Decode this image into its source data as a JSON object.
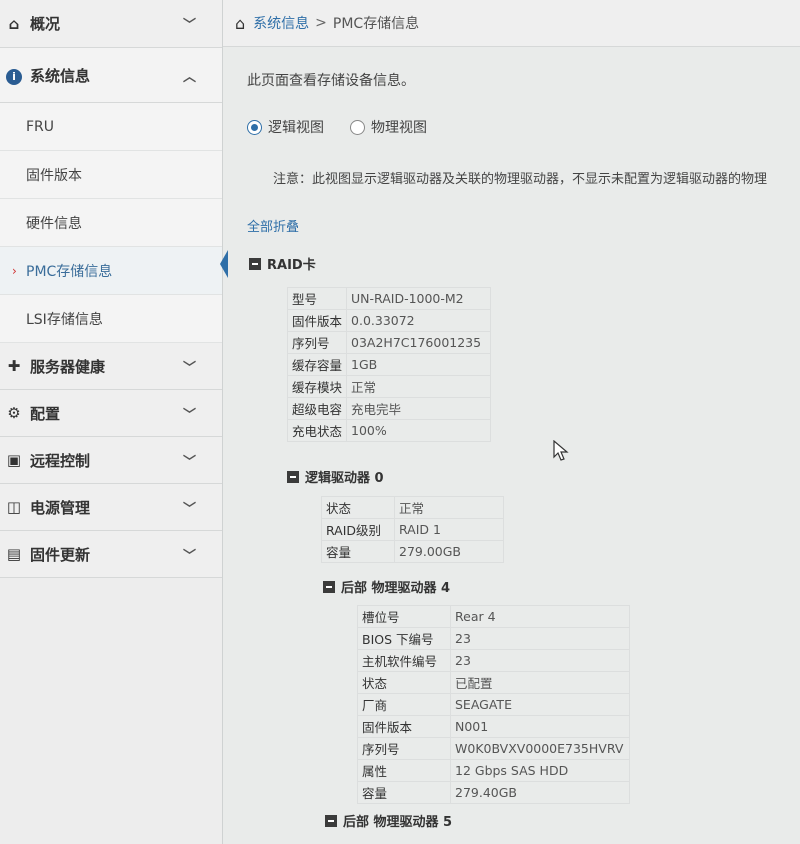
{
  "sidebar": {
    "groups": [
      {
        "label": "概况",
        "icon": "home-icon"
      },
      {
        "label": "系统信息",
        "icon": "info-icon"
      },
      {
        "label": "服务器健康",
        "icon": "health-icon"
      },
      {
        "label": "配置",
        "icon": "gear-icon"
      },
      {
        "label": "远程控制",
        "icon": "monitor-icon"
      },
      {
        "label": "电源管理",
        "icon": "power-icon"
      },
      {
        "label": "固件更新",
        "icon": "firmware-icon"
      }
    ],
    "system_items": [
      {
        "label": "FRU"
      },
      {
        "label": "固件版本"
      },
      {
        "label": "硬件信息"
      },
      {
        "label": "PMC存储信息",
        "active": true
      },
      {
        "label": "LSI存储信息"
      }
    ]
  },
  "breadcrumb": {
    "parent": "系统信息",
    "separator": ">",
    "current": "PMC存储信息"
  },
  "main": {
    "description": "此页面查看存储设备信息。",
    "view_options": [
      {
        "label": "逻辑视图",
        "checked": true
      },
      {
        "label": "物理视图",
        "checked": false
      }
    ],
    "note": "注意：此视图显示逻辑驱动器及关联的物理驱动器，不显示未配置为逻辑驱动器的物理",
    "collapse_all": "全部折叠",
    "raid_card": {
      "title": "RAID卡",
      "rows": [
        {
          "k": "型号",
          "v": "UN-RAID-1000-M2"
        },
        {
          "k": "固件版本",
          "v": "0.0.33072"
        },
        {
          "k": "序列号",
          "v": "03A2H7C176001235"
        },
        {
          "k": "缓存容量",
          "v": "1GB"
        },
        {
          "k": "缓存模块",
          "v": "正常"
        },
        {
          "k": "超级电容",
          "v": "充电完毕"
        },
        {
          "k": "充电状态",
          "v": "100%"
        }
      ]
    },
    "logical_drive": {
      "title": "逻辑驱动器 0",
      "rows": [
        {
          "k": "状态",
          "v": "正常"
        },
        {
          "k": "RAID级别",
          "v": "RAID 1"
        },
        {
          "k": "容量",
          "v": "279.00GB"
        }
      ]
    },
    "physical_drive_4": {
      "title": "后部 物理驱动器 4",
      "rows": [
        {
          "k": "槽位号",
          "v": "Rear 4"
        },
        {
          "k": "BIOS 下编号",
          "v": "23"
        },
        {
          "k": "主机软件编号",
          "v": "23"
        },
        {
          "k": "状态",
          "v": "已配置"
        },
        {
          "k": "厂商",
          "v": "SEAGATE"
        },
        {
          "k": "固件版本",
          "v": "N001"
        },
        {
          "k": "序列号",
          "v": "W0K0BVXV0000E735HVRV"
        },
        {
          "k": "属性",
          "v": "12 Gbps SAS HDD"
        },
        {
          "k": "容量",
          "v": "279.40GB"
        }
      ]
    },
    "physical_drive_5": {
      "title": "后部 物理驱动器 5"
    }
  }
}
